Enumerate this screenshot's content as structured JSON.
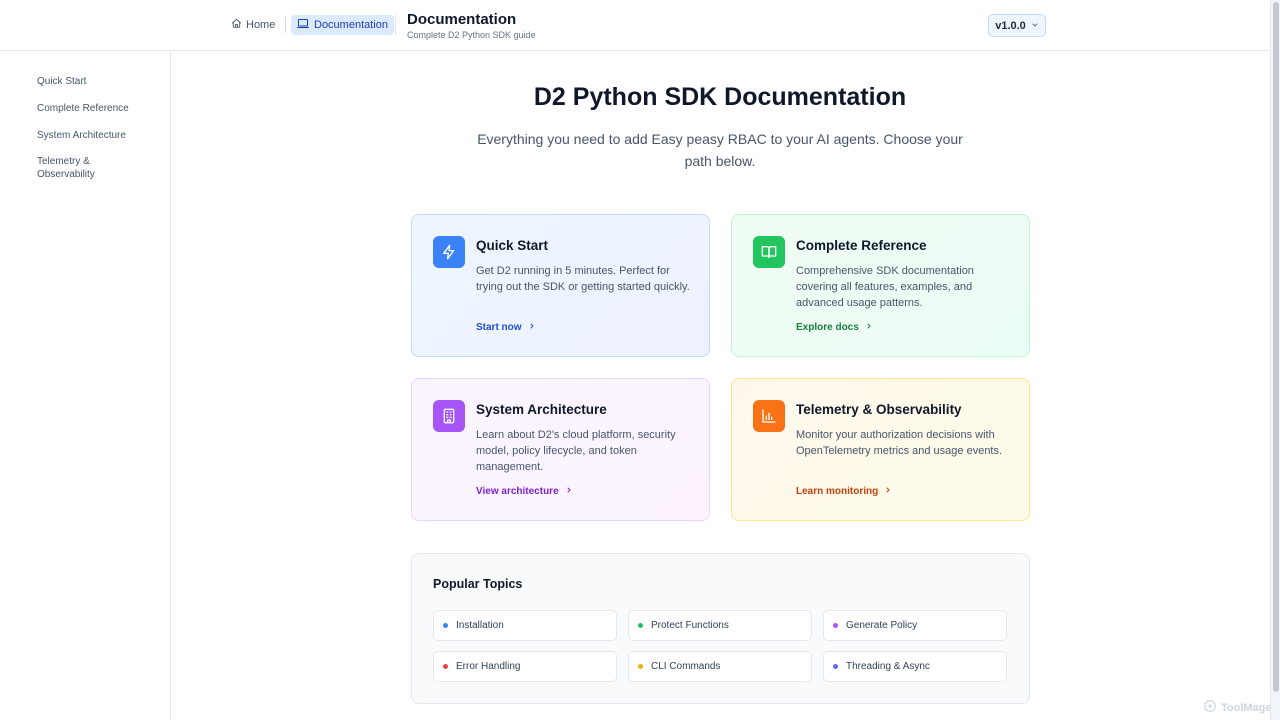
{
  "header": {
    "home_label": "Home",
    "docs_label": "Documentation",
    "title": "Documentation",
    "subtitle": "Complete D2 Python SDK guide",
    "version": "v1.0.0"
  },
  "sidebar": {
    "items": [
      {
        "label": "Quick Start"
      },
      {
        "label": "Complete Reference"
      },
      {
        "label": "System Architecture"
      },
      {
        "label": "Telemetry & Observability"
      }
    ]
  },
  "hero": {
    "title": "D2 Python SDK Documentation",
    "subtitle": "Everything you need to add Easy peasy RBAC to your AI agents. Choose your path below."
  },
  "cards": [
    {
      "title": "Quick Start",
      "desc": "Get D2 running in 5 minutes. Perfect for trying out the SDK or getting started quickly.",
      "link": "Start now",
      "icon": "lightning-icon",
      "accent": "#3b82f6",
      "link_color": "#1d4ed8"
    },
    {
      "title": "Complete Reference",
      "desc": "Comprehensive SDK documentation covering all features, examples, and advanced usage patterns.",
      "link": "Explore docs",
      "icon": "book-open-icon",
      "accent": "#22c55e",
      "link_color": "#15803d"
    },
    {
      "title": "System Architecture",
      "desc": "Learn about D2's cloud platform, security model, policy lifecycle, and token management.",
      "link": "View architecture",
      "icon": "building-icon",
      "accent": "#a855f7",
      "link_color": "#7e22ce"
    },
    {
      "title": "Telemetry & Observability",
      "desc": "Monitor your authorization decisions with OpenTelemetry metrics and usage events.",
      "link": "Learn monitoring",
      "icon": "bar-chart-icon",
      "accent": "#f97316",
      "link_color": "#c2410c"
    }
  ],
  "topics": {
    "title": "Popular Topics",
    "items": [
      {
        "label": "Installation",
        "color": "#3b82f6"
      },
      {
        "label": "Protect Functions",
        "color": "#22c55e"
      },
      {
        "label": "Generate Policy",
        "color": "#a855f7"
      },
      {
        "label": "Error Handling",
        "color": "#ef4444"
      },
      {
        "label": "CLI Commands",
        "color": "#eab308"
      },
      {
        "label": "Threading & Async",
        "color": "#6366f1"
      }
    ]
  },
  "watermark": "ToolMage"
}
